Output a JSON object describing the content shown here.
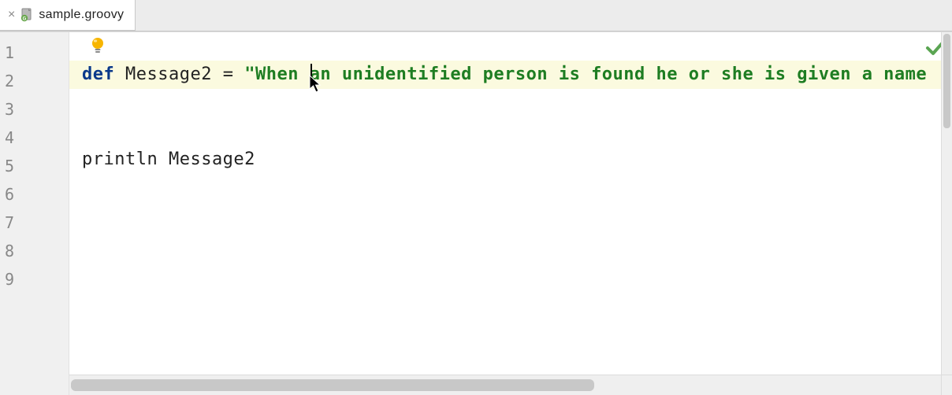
{
  "tab": {
    "filename": "sample.groovy",
    "filetype_icon": "groovy-file-icon"
  },
  "gutter": {
    "line_numbers": [
      "1",
      "2",
      "3",
      "4",
      "5",
      "6",
      "7",
      "8",
      "9"
    ]
  },
  "code": {
    "highlighted_line_index": 1,
    "lines": [
      {
        "tokens": []
      },
      {
        "tokens": [
          {
            "cls": "kw",
            "t": "def"
          },
          {
            "cls": "sp",
            "t": " "
          },
          {
            "cls": "id",
            "t": "Message2"
          },
          {
            "cls": "sp",
            "t": " "
          },
          {
            "cls": "op",
            "t": "="
          },
          {
            "cls": "sp",
            "t": " "
          },
          {
            "cls": "str",
            "t": "\"When an unidentified person is found he or she is given a name"
          }
        ]
      },
      {
        "tokens": []
      },
      {
        "tokens": []
      },
      {
        "tokens": [
          {
            "cls": "stmt",
            "t": "println Message2"
          }
        ]
      },
      {
        "tokens": []
      },
      {
        "tokens": []
      },
      {
        "tokens": []
      },
      {
        "tokens": []
      }
    ]
  },
  "icons": {
    "bulb": "intention-bulb-icon",
    "check": "inspection-ok-icon",
    "close": "close-icon",
    "cursor": "mouse-pointer-icon"
  }
}
